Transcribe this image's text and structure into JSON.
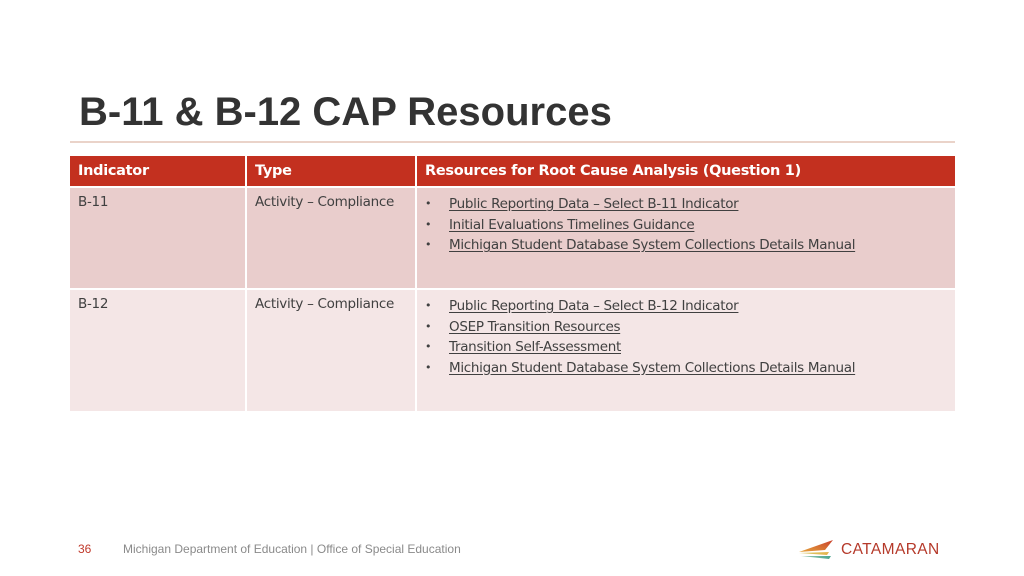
{
  "slide": {
    "title": "B-11 & B-12 CAP Resources"
  },
  "table": {
    "headers": [
      "Indicator",
      "Type",
      "Resources for Root Cause Analysis (Question 1)"
    ],
    "rows": [
      {
        "indicator": "B-11",
        "type": "Activity – Compliance",
        "resources": [
          "Public Reporting Data – Select B-11 Indicator",
          "Initial Evaluations Timelines Guidance",
          "Michigan Student Database System Collections Details Manual"
        ]
      },
      {
        "indicator": "B-12",
        "type": "Activity – Compliance",
        "resources": [
          "Public Reporting Data – Select B-12 Indicator",
          "OSEP Transition Resources",
          "Transition Self-Assessment",
          "Michigan Student Database System Collections Details Manual"
        ]
      }
    ],
    "bullet_glyph": "•"
  },
  "footer": {
    "page_number": "36",
    "text": "Michigan Department of Education | Office of Special Education"
  },
  "logo": {
    "name": "CATAMARAN",
    "icon": "catamaran-sail-logo-icon"
  },
  "colors": {
    "header_red": "#c3301f",
    "row_1_pink": "#e9cdcc",
    "row_2_pink": "#f4e6e6",
    "page_number_red": "#c0392b",
    "logo_red": "#b5392a"
  }
}
